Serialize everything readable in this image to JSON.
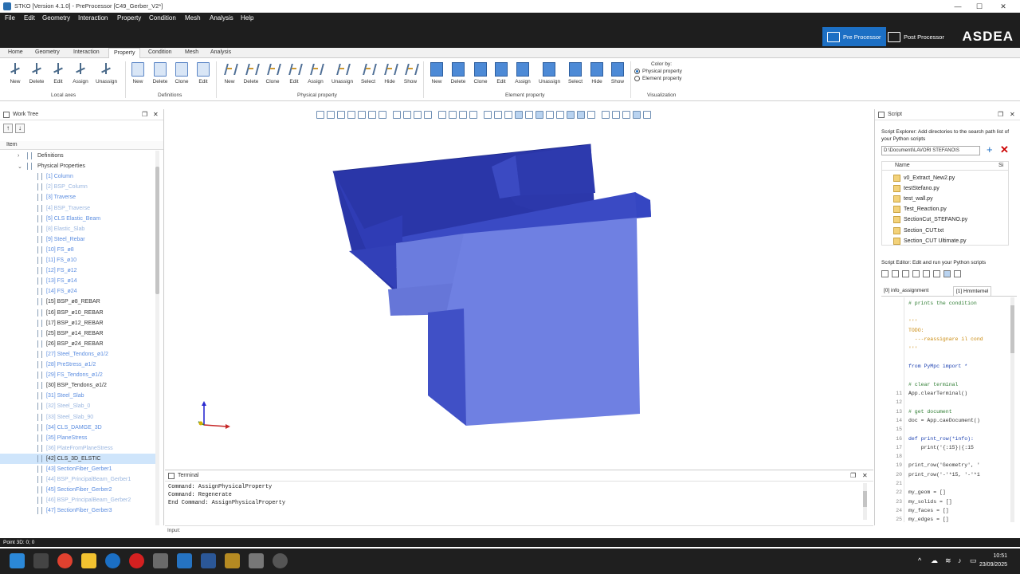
{
  "window": {
    "title": "STKO [Version 4.1.0] - PreProcessor [C49_Gerber_V2*]",
    "minimize": "—",
    "maximize": "☐",
    "close": "✕"
  },
  "menu": [
    "File",
    "Edit",
    "Geometry",
    "Interaction",
    "Property",
    "Condition",
    "Mesh",
    "Analysis",
    "Help"
  ],
  "brand": {
    "pre": "Pre Processor",
    "post": "Post Processor",
    "logo": "ASDEA"
  },
  "tabs": [
    "Home",
    "Geometry",
    "Interaction",
    "Property",
    "Condition",
    "Mesh",
    "Analysis"
  ],
  "ribbon": {
    "local_axes": {
      "label": "Local axes",
      "buttons": [
        "New",
        "Delete",
        "Edit",
        "Assign",
        "Unassign"
      ]
    },
    "definitions": {
      "label": "Definitions",
      "buttons": [
        "New",
        "Delete",
        "Clone",
        "Edit"
      ]
    },
    "physical": {
      "label": "Physical property",
      "buttons": [
        "New",
        "Delete",
        "Clone",
        "Edit",
        "Assign",
        "Unassign",
        "Select",
        "Hide",
        "Show"
      ]
    },
    "element": {
      "label": "Element property",
      "buttons": [
        "New",
        "Delete",
        "Clone",
        "Edit",
        "Assign",
        "Unassign",
        "Select",
        "Hide",
        "Show"
      ]
    },
    "color_by": {
      "title": "Color by:",
      "options": [
        "Physical property",
        "Element property"
      ],
      "selected": "Physical property",
      "group": "Visualization"
    }
  },
  "worktree": {
    "title": "Work Tree",
    "column": "Item",
    "nodes": [
      {
        "label": "Definitions",
        "level": 1,
        "expanded": false
      },
      {
        "label": "Physical Properties",
        "level": 1,
        "expanded": true
      },
      {
        "label": "[1] Column",
        "color": "#5b8de0"
      },
      {
        "label": "[2] BSP_Column",
        "color": "#9ab6e0"
      },
      {
        "label": "[3] Traverse",
        "color": "#5b8de0"
      },
      {
        "label": "[4] BSP_Traverse",
        "color": "#9ab6e0"
      },
      {
        "label": "[5] CLS Elastic_Beam",
        "color": "#5b8de0"
      },
      {
        "label": "[8] Elastic_Slab",
        "color": "#9ab6e0"
      },
      {
        "label": "[9] Steel_Rebar",
        "color": "#5b8de0"
      },
      {
        "label": "[10] FS_ø8",
        "color": "#5b8de0"
      },
      {
        "label": "[11] FS_ø10",
        "color": "#5b8de0"
      },
      {
        "label": "[12] FS_ø12",
        "color": "#5b8de0"
      },
      {
        "label": "[13] FS_ø14",
        "color": "#5b8de0"
      },
      {
        "label": "[14] FS_ø24",
        "color": "#5b8de0"
      },
      {
        "label": "[15] BSP_ø8_REBAR",
        "color": "#333333"
      },
      {
        "label": "[16] BSP_ø10_REBAR",
        "color": "#333333"
      },
      {
        "label": "[17] BSP_ø12_REBAR",
        "color": "#333333"
      },
      {
        "label": "[25] BSP_ø14_REBAR",
        "color": "#333333"
      },
      {
        "label": "[26] BSP_ø24_REBAR",
        "color": "#333333"
      },
      {
        "label": "[27] Steel_Tendons_ø1/2",
        "color": "#5b8de0"
      },
      {
        "label": "[28] PreStress_ø1/2",
        "color": "#5b8de0"
      },
      {
        "label": "[29] FS_Tendons_ø1/2",
        "color": "#5b8de0"
      },
      {
        "label": "[30] BSP_Tendons_ø1/2",
        "color": "#333333"
      },
      {
        "label": "[31] Steel_Slab",
        "color": "#5b8de0"
      },
      {
        "label": "[32] Steel_Slab_0",
        "color": "#9ab6e0"
      },
      {
        "label": "[33] Steel_Slab_90",
        "color": "#9ab6e0"
      },
      {
        "label": "[34] CLS_DAMGE_3D",
        "color": "#5b8de0"
      },
      {
        "label": "[35] PlaneStress",
        "color": "#5b8de0"
      },
      {
        "label": "[36] PlateFromPlaneStress",
        "color": "#9ab6e0"
      },
      {
        "label": "[42] CLS_3D_ELSTIC",
        "color": "#333333",
        "selected": true
      },
      {
        "label": "[43] SectionFiber_Gerber1",
        "color": "#5b8de0"
      },
      {
        "label": "[44] BSP_PrincipalBeam_Gerber1",
        "color": "#9ab6e0"
      },
      {
        "label": "[45] SectionFiber_Gerber2",
        "color": "#5b8de0"
      },
      {
        "label": "[46] BSP_PrincipalBeam_Gerber2",
        "color": "#9ab6e0"
      },
      {
        "label": "[47] SectionFiber_Gerber3",
        "color": "#5b8de0"
      }
    ]
  },
  "terminal": {
    "title": "Terminal",
    "lines": [
      "Command: AssignPhysicalProperty",
      "Command: Regenerate",
      "End Command: AssignPhysicalProperty"
    ],
    "input_label": "Input:"
  },
  "script": {
    "title": "Script",
    "explorer_desc": "Script Explorer: Add directories to the search path list of your Python scripts",
    "path": "D:\\Documenti\\LAVORI STEFANO\\S",
    "add": "+",
    "remove": "✕",
    "file_header": "Name",
    "file_header2": "Si",
    "files": [
      "v0_Extract_New2.py",
      "testStefano.py",
      "test_wall.py",
      "Test_Reaction.py",
      "SectionCut_STEFANO.py",
      "Section_CUT.txt",
      "Section_CUT Ultimate.py"
    ],
    "editor_desc": "Script Editor: Edit and run your Python scripts",
    "editor_tabs": [
      "[0] info_assignment",
      "[1] Hmmtemel"
    ],
    "code": [
      {
        "n": "",
        "t": "# prints the condition"
      },
      {
        "n": "",
        "t": ""
      },
      {
        "n": "",
        "t": "'''"
      },
      {
        "n": "",
        "t": "TODO:"
      },
      {
        "n": "",
        "t": "  ---reassignare il cond"
      },
      {
        "n": "",
        "t": "'''"
      },
      {
        "n": "",
        "t": ""
      },
      {
        "n": "",
        "t": "from PyMpc import *"
      },
      {
        "n": "",
        "t": ""
      },
      {
        "n": "",
        "t": "# clear terminal"
      },
      {
        "n": "11",
        "t": "App.clearTerminal()"
      },
      {
        "n": "12",
        "t": ""
      },
      {
        "n": "13",
        "t": "# get document"
      },
      {
        "n": "14",
        "t": "doc = App.caeDocument()"
      },
      {
        "n": "15",
        "t": ""
      },
      {
        "n": "16",
        "t": "def print_row(*info):"
      },
      {
        "n": "17",
        "t": "    print('{:15}|{:15"
      },
      {
        "n": "18",
        "t": ""
      },
      {
        "n": "19",
        "t": "print_row('Geometry', '"
      },
      {
        "n": "20",
        "t": "print_row('-'*15, '-'*1"
      },
      {
        "n": "21",
        "t": ""
      },
      {
        "n": "22",
        "t": "my_geom = []"
      },
      {
        "n": "23",
        "t": "my_solids = []"
      },
      {
        "n": "24",
        "t": "my_faces = []"
      },
      {
        "n": "25",
        "t": "my_edges = []"
      }
    ]
  },
  "status": {
    "text": "Point 3D: 0; 0"
  },
  "clock": {
    "time": "10:51",
    "date": "23/09/2025"
  },
  "colors": {
    "solid_top": "#2c3cb0",
    "solid_front": "#6d7ee0",
    "solid_side": "#3546c2",
    "accent": "#1c6fc4"
  }
}
